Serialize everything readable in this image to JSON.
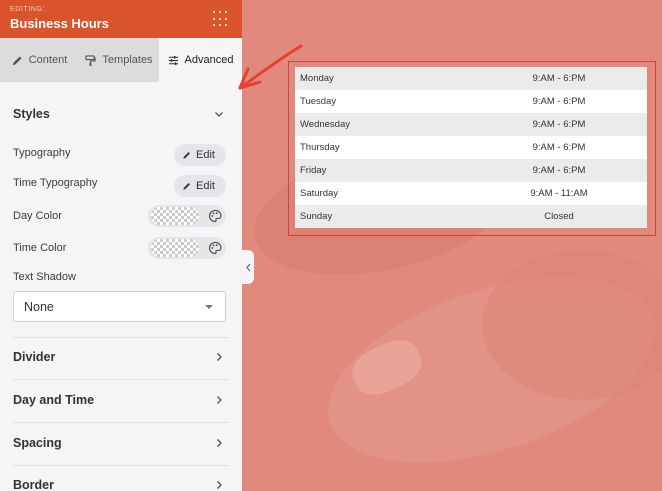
{
  "header": {
    "eyebrow": "EDITING:",
    "title": "Business Hours"
  },
  "tabs": [
    {
      "label": "Content",
      "icon": "pencil-icon"
    },
    {
      "label": "Templates",
      "icon": "paint-roller-icon"
    },
    {
      "label": "Advanced",
      "icon": "sliders-icon",
      "active": true
    }
  ],
  "styles": {
    "title": "Styles",
    "typography_label": "Typography",
    "time_typography_label": "Time Typography",
    "edit_label": "Edit",
    "day_color_label": "Day Color",
    "time_color_label": "Time Color",
    "text_shadow_label": "Text Shadow",
    "text_shadow_value": "None"
  },
  "sections": {
    "divider": "Divider",
    "day_and_time": "Day and Time",
    "spacing": "Spacing",
    "border": "Border"
  },
  "hours": [
    {
      "day": "Monday",
      "time": "9:AM - 6:PM"
    },
    {
      "day": "Tuesday",
      "time": "9:AM - 6:PM"
    },
    {
      "day": "Wednesday",
      "time": "9:AM - 6:PM"
    },
    {
      "day": "Thursday",
      "time": "9:AM - 6:PM"
    },
    {
      "day": "Friday",
      "time": "9:AM - 6:PM"
    },
    {
      "day": "Saturday",
      "time": "9:AM - 11:AM"
    },
    {
      "day": "Sunday",
      "time": "Closed"
    }
  ],
  "colors": {
    "brand": "#d9532b",
    "canvas": "#e0897c",
    "arrow": "#e8402e"
  }
}
